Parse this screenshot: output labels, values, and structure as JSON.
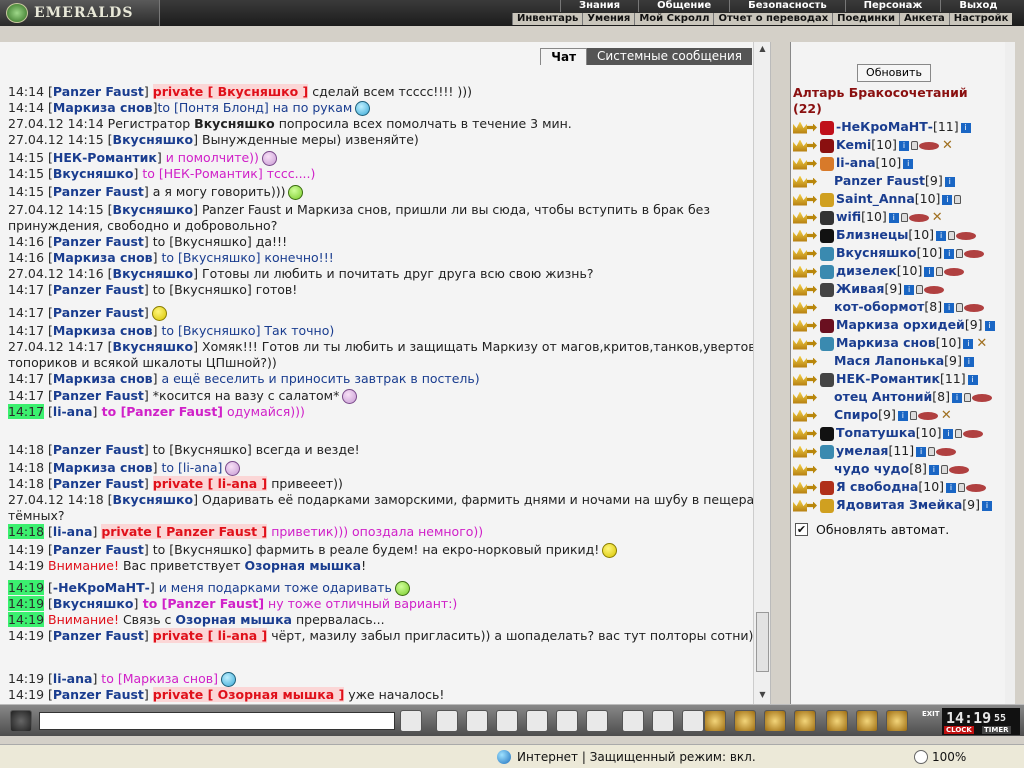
{
  "top_menu": {
    "logo_text": "EMERALDS",
    "row1": [
      "Знания",
      "Общение",
      "Безопасность",
      "Персонаж",
      "Выход"
    ],
    "row2": [
      "Инвентарь",
      "Умения",
      "Мой Скролл",
      "Отчет о переводах",
      "Поединки",
      "Анкета",
      "Настройк"
    ]
  },
  "chat": {
    "tabs": {
      "chat": "Чат",
      "system": "Системные сообщения"
    },
    "lines": [
      {
        "ts": "14:14",
        "a": "[",
        "nick": "Panzer Faust",
        "b": "]",
        "priv": "private [ Вкусняшко ]",
        "text": " сделай всем тсссс!!!! )))"
      },
      {
        "ts": "14:14",
        "a": "[",
        "nick": "Маркиза снов",
        "b": "]",
        "to": "to [Понтя Блонд] на по рукам"
      },
      {
        "ts": "27.04.12 14:14",
        "text": "Регистратор ",
        "bold": "Вкусняшко",
        "text2": " попросила всех помолчать в течение 3 мин."
      },
      {
        "ts": "27.04.12 14:15",
        "a": "[",
        "nick": "Вкусняшко",
        "b": "]",
        "text": " Вынужденные меры) извеняйте)"
      },
      {
        "ts": "14:15",
        "a": "[",
        "nick": "НЕК-Романтик",
        "b": "]",
        "pink": " и помолчите))"
      },
      {
        "ts": "14:15",
        "a": "[",
        "nick": "Вкусняшко",
        "b": "]",
        "pink": " to [НЕК-Романтик] тссс....)"
      },
      {
        "ts": "14:15",
        "a": "[",
        "nick": "Panzer Faust",
        "b": "]",
        "text": " а я могу говорить)))"
      },
      {
        "ts": "27.04.12 14:15",
        "a": "[",
        "nick": "Вкусняшко",
        "b": "]",
        "text": " Panzer Faust и Маркиза снов, пришли ли вы сюда, чтобы вступить в брак без принуждения, свободно и добровольно?"
      },
      {
        "ts": "14:16",
        "a": "[",
        "nick": "Panzer Faust",
        "b": "]",
        "text": " to [Вкусняшко] да!!!"
      },
      {
        "ts": "14:16",
        "a": "[",
        "nick": "Маркиза снов",
        "b": "]",
        "to": " to [Вкусняшко] конечно!!!"
      },
      {
        "ts": "27.04.12 14:16",
        "a": "[",
        "nick": "Вкусняшко",
        "b": "]",
        "text": " Готовы ли любить и почитать друг друга всю свою жизнь?"
      },
      {
        "ts": "14:17",
        "a": "[",
        "nick": "Panzer Faust",
        "b": "]",
        "text": " to [Вкусняшко] готов!"
      },
      {
        "ts": "14:17",
        "a": "[",
        "nick": "Panzer Faust",
        "b": "]",
        "text": ""
      },
      {
        "ts": "14:17",
        "a": "[",
        "nick": "Маркиза снов",
        "b": "]",
        "to": " to [Вкусняшко] Так точно)"
      },
      {
        "ts": "27.04.12 14:17",
        "a": "[",
        "nick": "Вкусняшко",
        "b": "]",
        "text": " Хомяк!!! Готов ли ты любить и защищать Маркизу от магов,критов,танков,увертов, топориков и всякой шкалоты ЦПшной?))"
      },
      {
        "ts": "14:17",
        "a": "[",
        "nick": "Маркиза снов",
        "b": "]",
        "to": " а ещё веселить и приносить завтрак в постель)"
      },
      {
        "ts": "14:17",
        "a": "[",
        "nick": "Panzer Faust",
        "b": "]",
        "text": " *косится на вазу с салатом*"
      },
      {
        "ts": "14:17",
        "a": "[",
        "nick": "li-ana",
        "b": "]",
        "pinkb": " to [Panzer Faust]",
        "pink": " одумайся)))"
      },
      {
        "ts": "14:18",
        "a": "[",
        "nick": "Panzer Faust",
        "b": "]",
        "text": " to [Вкусняшко] всегда и везде!"
      },
      {
        "ts": "14:18",
        "a": "[",
        "nick": "Маркиза снов",
        "b": "]",
        "to": " to [li-ana]"
      },
      {
        "ts": "14:18",
        "a": "[",
        "nick": "Panzer Faust",
        "b": "]",
        "priv": "private [ li-ana ]",
        "text": " привееет))"
      },
      {
        "ts": "27.04.12 14:18",
        "a": "[",
        "nick": "Вкусняшко",
        "b": "]",
        "text": " Одаривать её подарками заморскими, фармить днями и ночами на шубу в пещерах тёмных?"
      },
      {
        "ts": "14:18",
        "a": "[",
        "nick": "li-ana",
        "b": "]",
        "priv": "private [ Panzer Faust ]",
        "pink": " приветик))) опоздала немного))"
      },
      {
        "ts": "14:19",
        "a": "[",
        "nick": "Panzer Faust",
        "b": "]",
        "text": " to [Вкусняшко] фармить в реале будем! на екро-норковый прикид!"
      },
      {
        "ts": "14:19",
        "red": "Внимание!",
        "text": " Вас приветствует ",
        "navy": "Озорная мышка",
        "text2": "!"
      },
      {
        "ts": "14:19",
        "a": "[",
        "nick": "-НеКроМаНТ-",
        "b": "]",
        "to": " и меня подарками тоже одаривать"
      },
      {
        "ts": "14:19",
        "a": "[",
        "nick": "Вкусняшко",
        "b": "]",
        "pinkb": " to [Panzer Faust]",
        "pink": " ну тоже отличный вариант:)"
      },
      {
        "ts": "14:19",
        "red": "Внимание!",
        "text": " Связь с ",
        "navy": "Озорная мышка",
        "text2": " прервалась..."
      },
      {
        "ts": "14:19",
        "a": "[",
        "nick": "Panzer Faust",
        "b": "]",
        "priv": "private [ li-ana ]",
        "text": " чёрт, мазилу забыл пригласить)) а шопаделать? вас тут полторы сотни)))"
      },
      {
        "ts": "14:19",
        "a": "[",
        "nick": "li-ana",
        "b": "]",
        "pink": " to [Маркиза снов]"
      },
      {
        "ts": "14:19",
        "a": "[",
        "nick": "Panzer Faust",
        "b": "]",
        "priv": "private [ Озорная мышка ]",
        "text": " уже началось!"
      }
    ]
  },
  "room": {
    "refresh_label": "Обновить",
    "title": "Алтарь Бракосочетаний",
    "count": "(22)",
    "users": [
      {
        "name": "-НеКроМаНТ-",
        "level": "[11]",
        "clan": "#c0101a"
      },
      {
        "name": "Kemi",
        "level": "[10]",
        "clan": "#8a1010"
      },
      {
        "name": "li-ana",
        "level": "[10]",
        "clan": "#d87a2a"
      },
      {
        "name": "Panzer Faust",
        "level": "[9]",
        "clan": ""
      },
      {
        "name": "Saint_Anna",
        "level": "[10]",
        "clan": "#d0a020"
      },
      {
        "name": "wifi",
        "level": "[10]",
        "clan": "#333"
      },
      {
        "name": "Близнецы",
        "level": "[10]",
        "clan": "#111"
      },
      {
        "name": "Вкусняшко",
        "level": "[10]",
        "clan": "#3a8ab0"
      },
      {
        "name": "дизелек",
        "level": "[10]",
        "clan": "#3a8ab0"
      },
      {
        "name": "Живая",
        "level": "[9]",
        "clan": "#444"
      },
      {
        "name": "кот-обормот",
        "level": "[8]",
        "clan": ""
      },
      {
        "name": "Маркиза орхидей",
        "level": "[9]",
        "clan": "#6a1020"
      },
      {
        "name": "Маркиза снов",
        "level": "[10]",
        "clan": "#3a8ab0"
      },
      {
        "name": "Мася Лапонька",
        "level": "[9]",
        "clan": ""
      },
      {
        "name": "НЕК-Романтик",
        "level": "[11]",
        "clan": "#444"
      },
      {
        "name": "отец Антоний",
        "level": "[8]",
        "clan": ""
      },
      {
        "name": "Спиро",
        "level": "[9]",
        "clan": ""
      },
      {
        "name": "Топатушка",
        "level": "[10]",
        "clan": "#111"
      },
      {
        "name": "умелая",
        "level": "[11]",
        "clan": "#3a8ab0"
      },
      {
        "name": "чудо чудо",
        "level": "[8]",
        "clan": ""
      },
      {
        "name": "Я свободна",
        "level": "[10]",
        "clan": "#b0301a"
      },
      {
        "name": "Ядовитая Змейка",
        "level": "[9]",
        "clan": "#d0a020"
      }
    ],
    "auto_refresh_label": "Обновлять автомат."
  },
  "clock": {
    "time": "14:19",
    "seconds": "55",
    "clock_label": "CLOCK",
    "timer_label": "TIMER",
    "exit_label": "EXIT"
  },
  "status": {
    "text": "Интернет | Защищенный режим: вкл.",
    "zoom": "100%"
  }
}
